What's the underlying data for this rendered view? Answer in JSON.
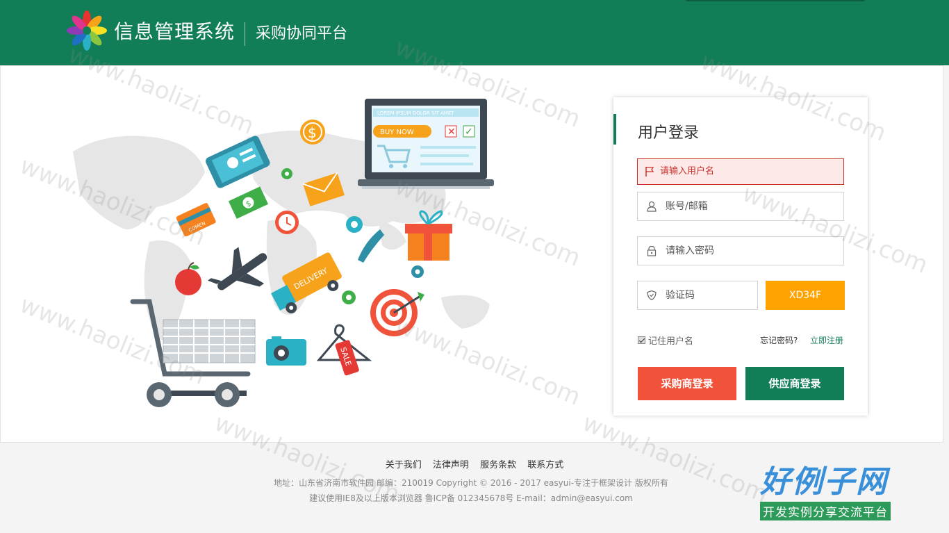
{
  "header": {
    "brand": "信息管理系统",
    "platform": "采购协同平台",
    "colors": {
      "primary": "#127e57"
    }
  },
  "illustration": {
    "laptop_banner": "LOREM IPSUM DOLOR SIT AMET",
    "buy_now": "BUY NOW",
    "delivery": "DELIVERY",
    "sale": "SALE",
    "coupon": "COMEN"
  },
  "login": {
    "title": "用户登录",
    "error": "请输入用户名",
    "username_placeholder": "账号/邮箱",
    "password_placeholder": "请输入密码",
    "code_placeholder": "验证码",
    "captcha": "XD34F",
    "remember": "记住用户名",
    "forgot": "忘记密码?",
    "register": "立即注册",
    "buyer_login": "采购商登录",
    "supplier_login": "供应商登录",
    "colors": {
      "error": "#c9302c",
      "captcha": "#ffa300",
      "buyer": "#f0533a",
      "supplier": "#127e57"
    }
  },
  "footer": {
    "links": [
      "关于我们",
      "法律声明",
      "服务条款",
      "联系方式"
    ],
    "line1": "地址：山东省济南市软件园 邮编：210019 Copyright © 2016 - 2017 easyui-专注于框架设计 版权所有",
    "line2": "建议使用IE8及以上版本浏览器 鲁ICP备 012345678号 E-mail：admin@easyui.com"
  },
  "watermark": {
    "text": "www.haolizi.com",
    "brand_title": "好例子网",
    "brand_sub": "开发实例分享交流平台"
  }
}
